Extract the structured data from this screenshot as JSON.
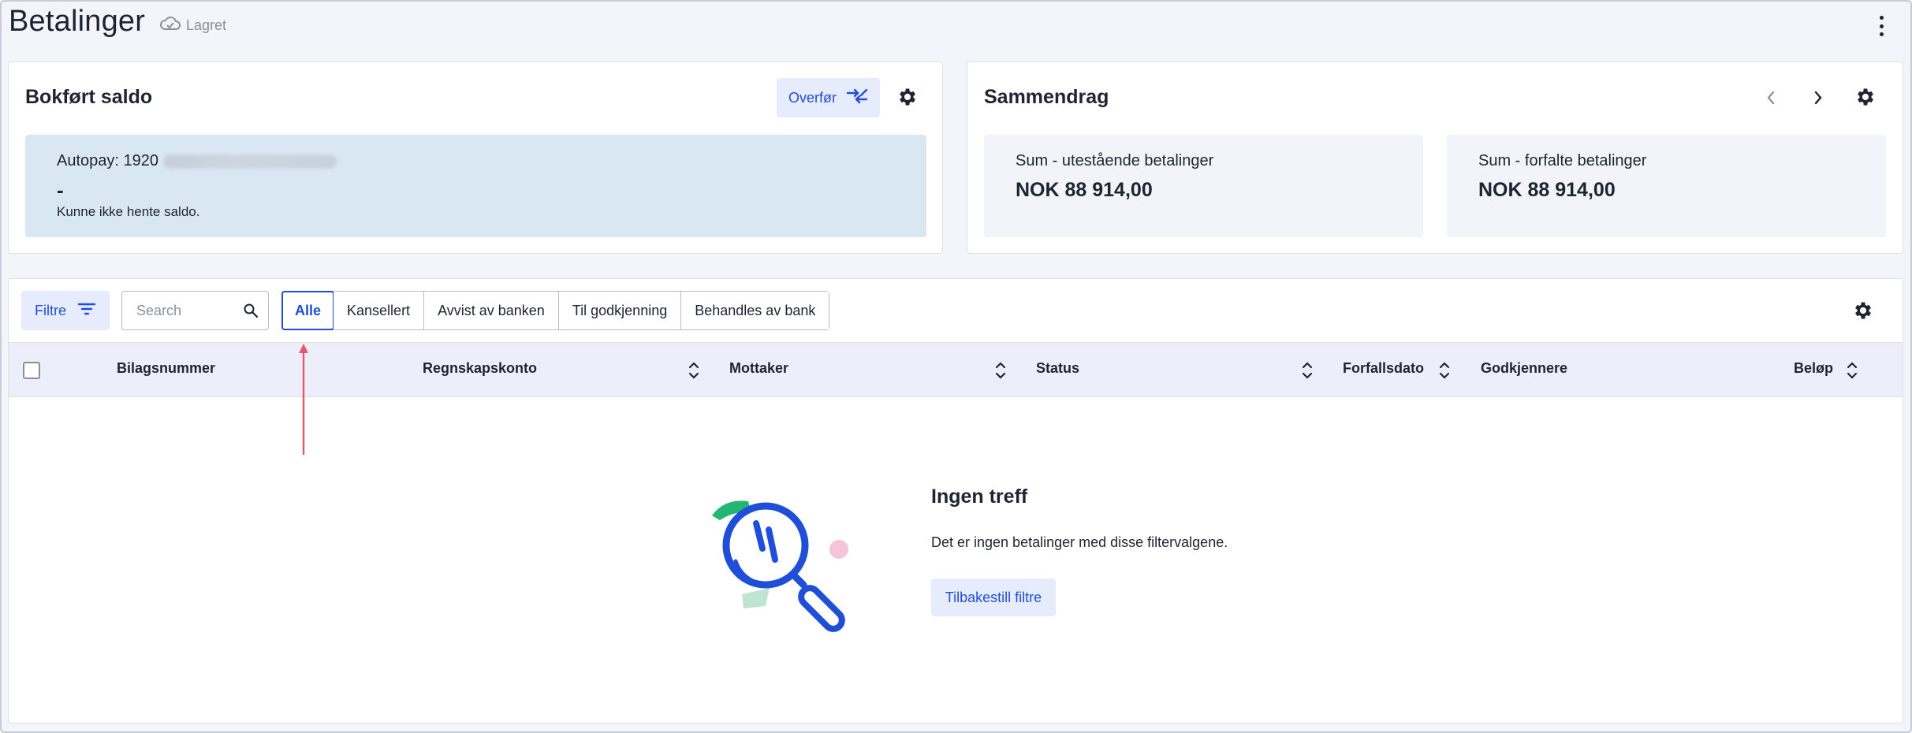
{
  "header": {
    "title": "Betalinger",
    "saved_label": "Lagret"
  },
  "balance_card": {
    "title": "Bokført saldo",
    "transfer_label": "Overfør",
    "account_label": "Autopay: 1920",
    "balance_value": "-",
    "error_text": "Kunne ikke hente saldo."
  },
  "summary_card": {
    "title": "Sammendrag",
    "items": [
      {
        "label": "Sum - utestående betalinger",
        "value": "NOK 88 914,00"
      },
      {
        "label": "Sum - forfalte betalinger",
        "value": "NOK 88 914,00"
      }
    ]
  },
  "toolbar": {
    "filter_label": "Filtre",
    "search_placeholder": "Search",
    "tabs": [
      "Alle",
      "Kansellert",
      "Avvist av banken",
      "Til godkjenning",
      "Behandles av bank"
    ],
    "active_tab": "Alle"
  },
  "table": {
    "columns": [
      "Bilagsnummer",
      "Regnskapskonto",
      "Mottaker",
      "Status",
      "Forfallsdato",
      "Godkjennere",
      "Beløp"
    ]
  },
  "empty_state": {
    "title": "Ingen treff",
    "description": "Det er ingen betalinger med disse filtervalgene.",
    "reset_label": "Tilbakestill filtre"
  },
  "colors": {
    "accent": "#1f4fd8",
    "accent_soft": "#e6ecfb",
    "balance_bg": "#d9e7f2",
    "annotation": "#e05a6a"
  },
  "icons": [
    "cloud-check-icon",
    "kebab-menu-icon",
    "transfer-arrows-icon",
    "gear-icon",
    "chevron-left-icon",
    "chevron-right-icon",
    "filter-icon",
    "search-icon",
    "sort-icon",
    "magnifier-illustration"
  ]
}
